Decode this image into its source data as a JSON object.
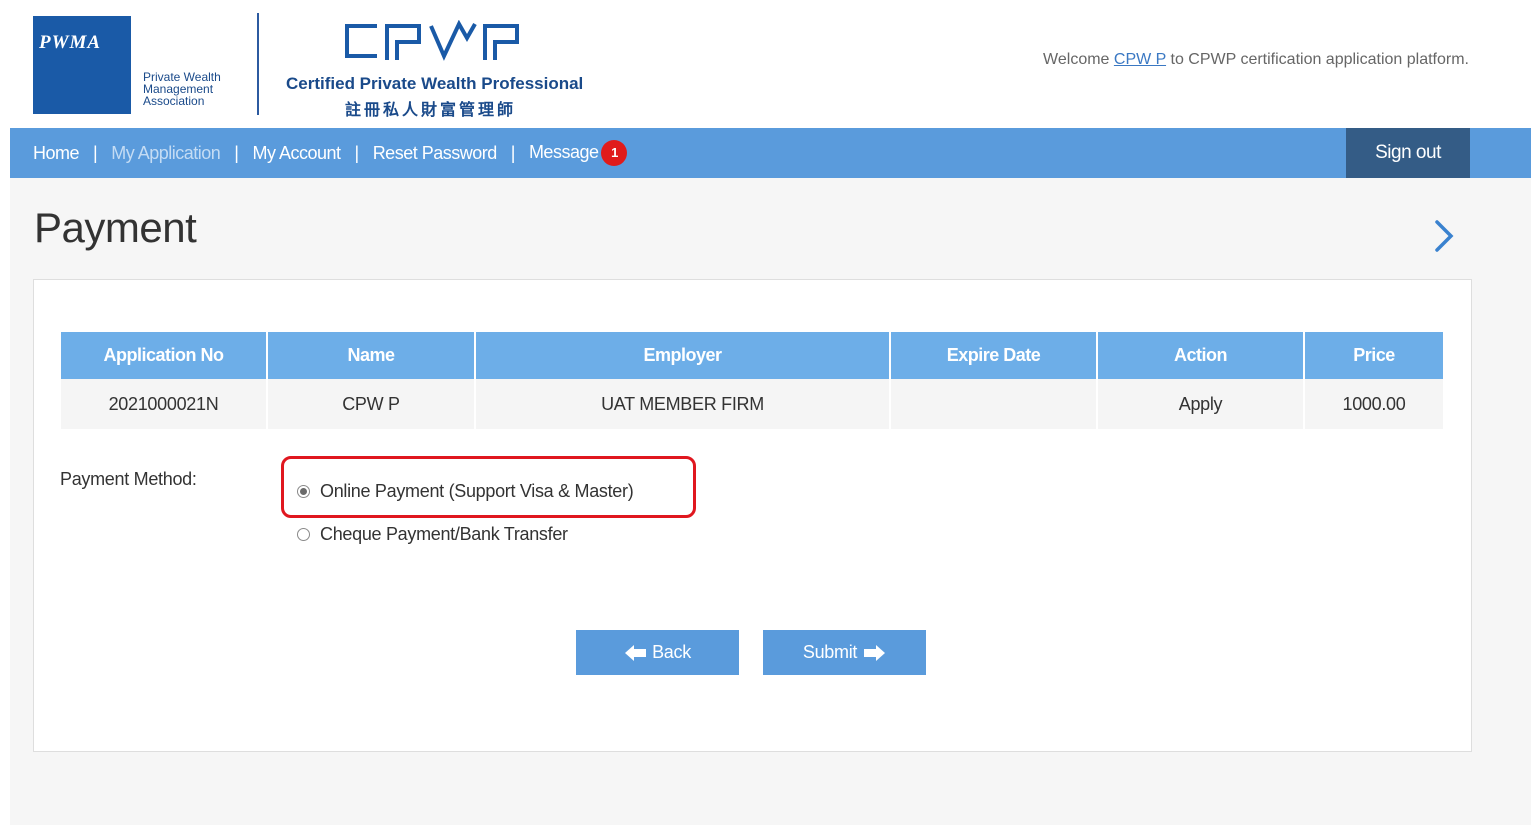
{
  "header": {
    "pwma_logo_text": "PWMA",
    "pwma_name_lines": [
      "Private Wealth",
      "Management",
      "Association"
    ],
    "cpwp_mark_text": "CPWP",
    "cpwp_title": "Certified Private Wealth Professional",
    "cpwp_chinese": "註冊私人財富管理師",
    "welcome_prefix": "Welcome ",
    "welcome_user": "CPW P",
    "welcome_suffix": " to CPWP certification application platform."
  },
  "nav": {
    "items": [
      {
        "label": "Home"
      },
      {
        "label": "My Application"
      },
      {
        "label": "My Account"
      },
      {
        "label": "Reset Password"
      },
      {
        "label": "Message"
      }
    ],
    "message_count": "1",
    "signout_label": "Sign out"
  },
  "page": {
    "title": "Payment"
  },
  "table": {
    "headers": [
      "Application No",
      "Name",
      "Employer",
      "Expire Date",
      "Action",
      "Price"
    ],
    "row": [
      "2021000021N",
      "CPW P",
      "UAT MEMBER FIRM",
      "",
      "Apply",
      "1000.00"
    ]
  },
  "payment": {
    "label": "Payment Method:",
    "options": [
      {
        "label": "Online Payment (Support Visa & Master)",
        "selected": true
      },
      {
        "label": "Cheque Payment/Bank Transfer",
        "selected": false
      }
    ]
  },
  "buttons": {
    "back_label": "Back",
    "submit_label": "Submit"
  },
  "colors": {
    "nav_bg": "#5a9bdc",
    "signout_bg": "#345c86",
    "table_header_bg": "#6daee8",
    "badge": "#e01b1b",
    "highlight": "#e0171f",
    "brand": "#1a5aa7"
  }
}
